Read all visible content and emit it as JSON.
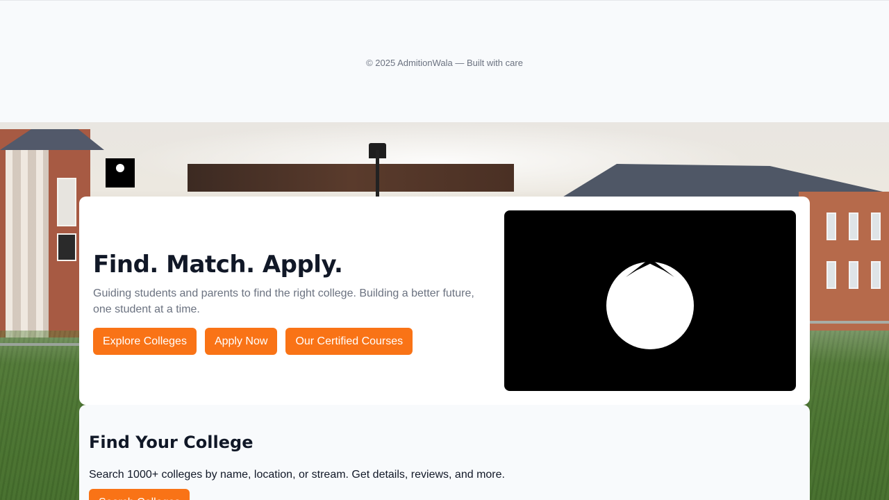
{
  "footer": {
    "text": "© 2025 AdmitionWala — Built with care"
  },
  "logo": {
    "icon": "logo-icon"
  },
  "hero": {
    "title": "Find. Match. Apply.",
    "subtitle": "Guiding students and parents to find the right college. Building a better future, one student at a time.",
    "buttons": [
      {
        "label": "Explore Colleges"
      },
      {
        "label": "Apply Now"
      },
      {
        "label": "Our Certified Courses"
      }
    ],
    "media_icon": "video-placeholder-icon"
  },
  "find_college": {
    "title": "Find Your College",
    "description": "Search 1000+ colleges by name, location, or stream. Get details, reviews, and more.",
    "button_label": "Search Colleges"
  },
  "colors": {
    "accent": "#f97316",
    "heading": "#111827",
    "muted": "#6b7280"
  }
}
